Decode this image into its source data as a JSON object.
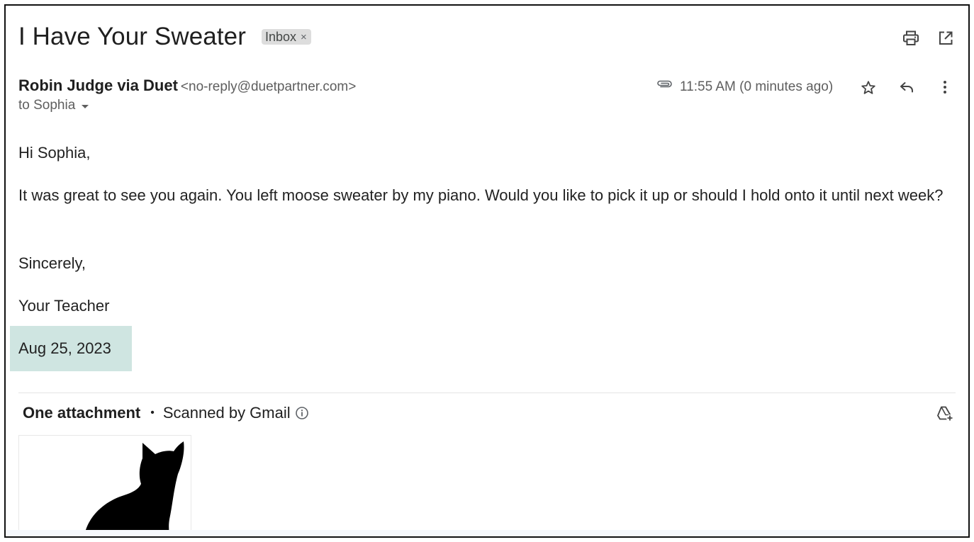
{
  "email": {
    "subject": "I Have Your Sweater",
    "label": "Inbox",
    "label_remove": "×",
    "sender_name": "Robin Judge via Duet",
    "sender_email": "<no-reply@duetpartner.com>",
    "recipient": "to Sophia",
    "time": "11:55 AM (0 minutes ago)",
    "body": {
      "greeting": "Hi Sophia,",
      "paragraph": "It was great to see you again. You left moose sweater by my piano. Would you like to pick it up or should I hold onto it until next week?",
      "closing": "Sincerely,",
      "signature": "Your Teacher",
      "date": "Aug 25, 2023"
    }
  },
  "attachments": {
    "title": "One attachment",
    "separator": "•",
    "scanned": "Scanned by Gmail"
  },
  "icons": {
    "print": "print-icon",
    "open_new_window": "open-in-new-window-icon",
    "attachment": "paperclip-icon",
    "star": "star-icon",
    "reply": "reply-icon",
    "more": "more-vertical-icon",
    "info": "info-icon",
    "drive": "add-to-drive-icon"
  },
  "colors": {
    "date_highlight": "#cfe5e1",
    "label_chip": "#dddddd",
    "secondary_text": "#5e5e5e"
  }
}
